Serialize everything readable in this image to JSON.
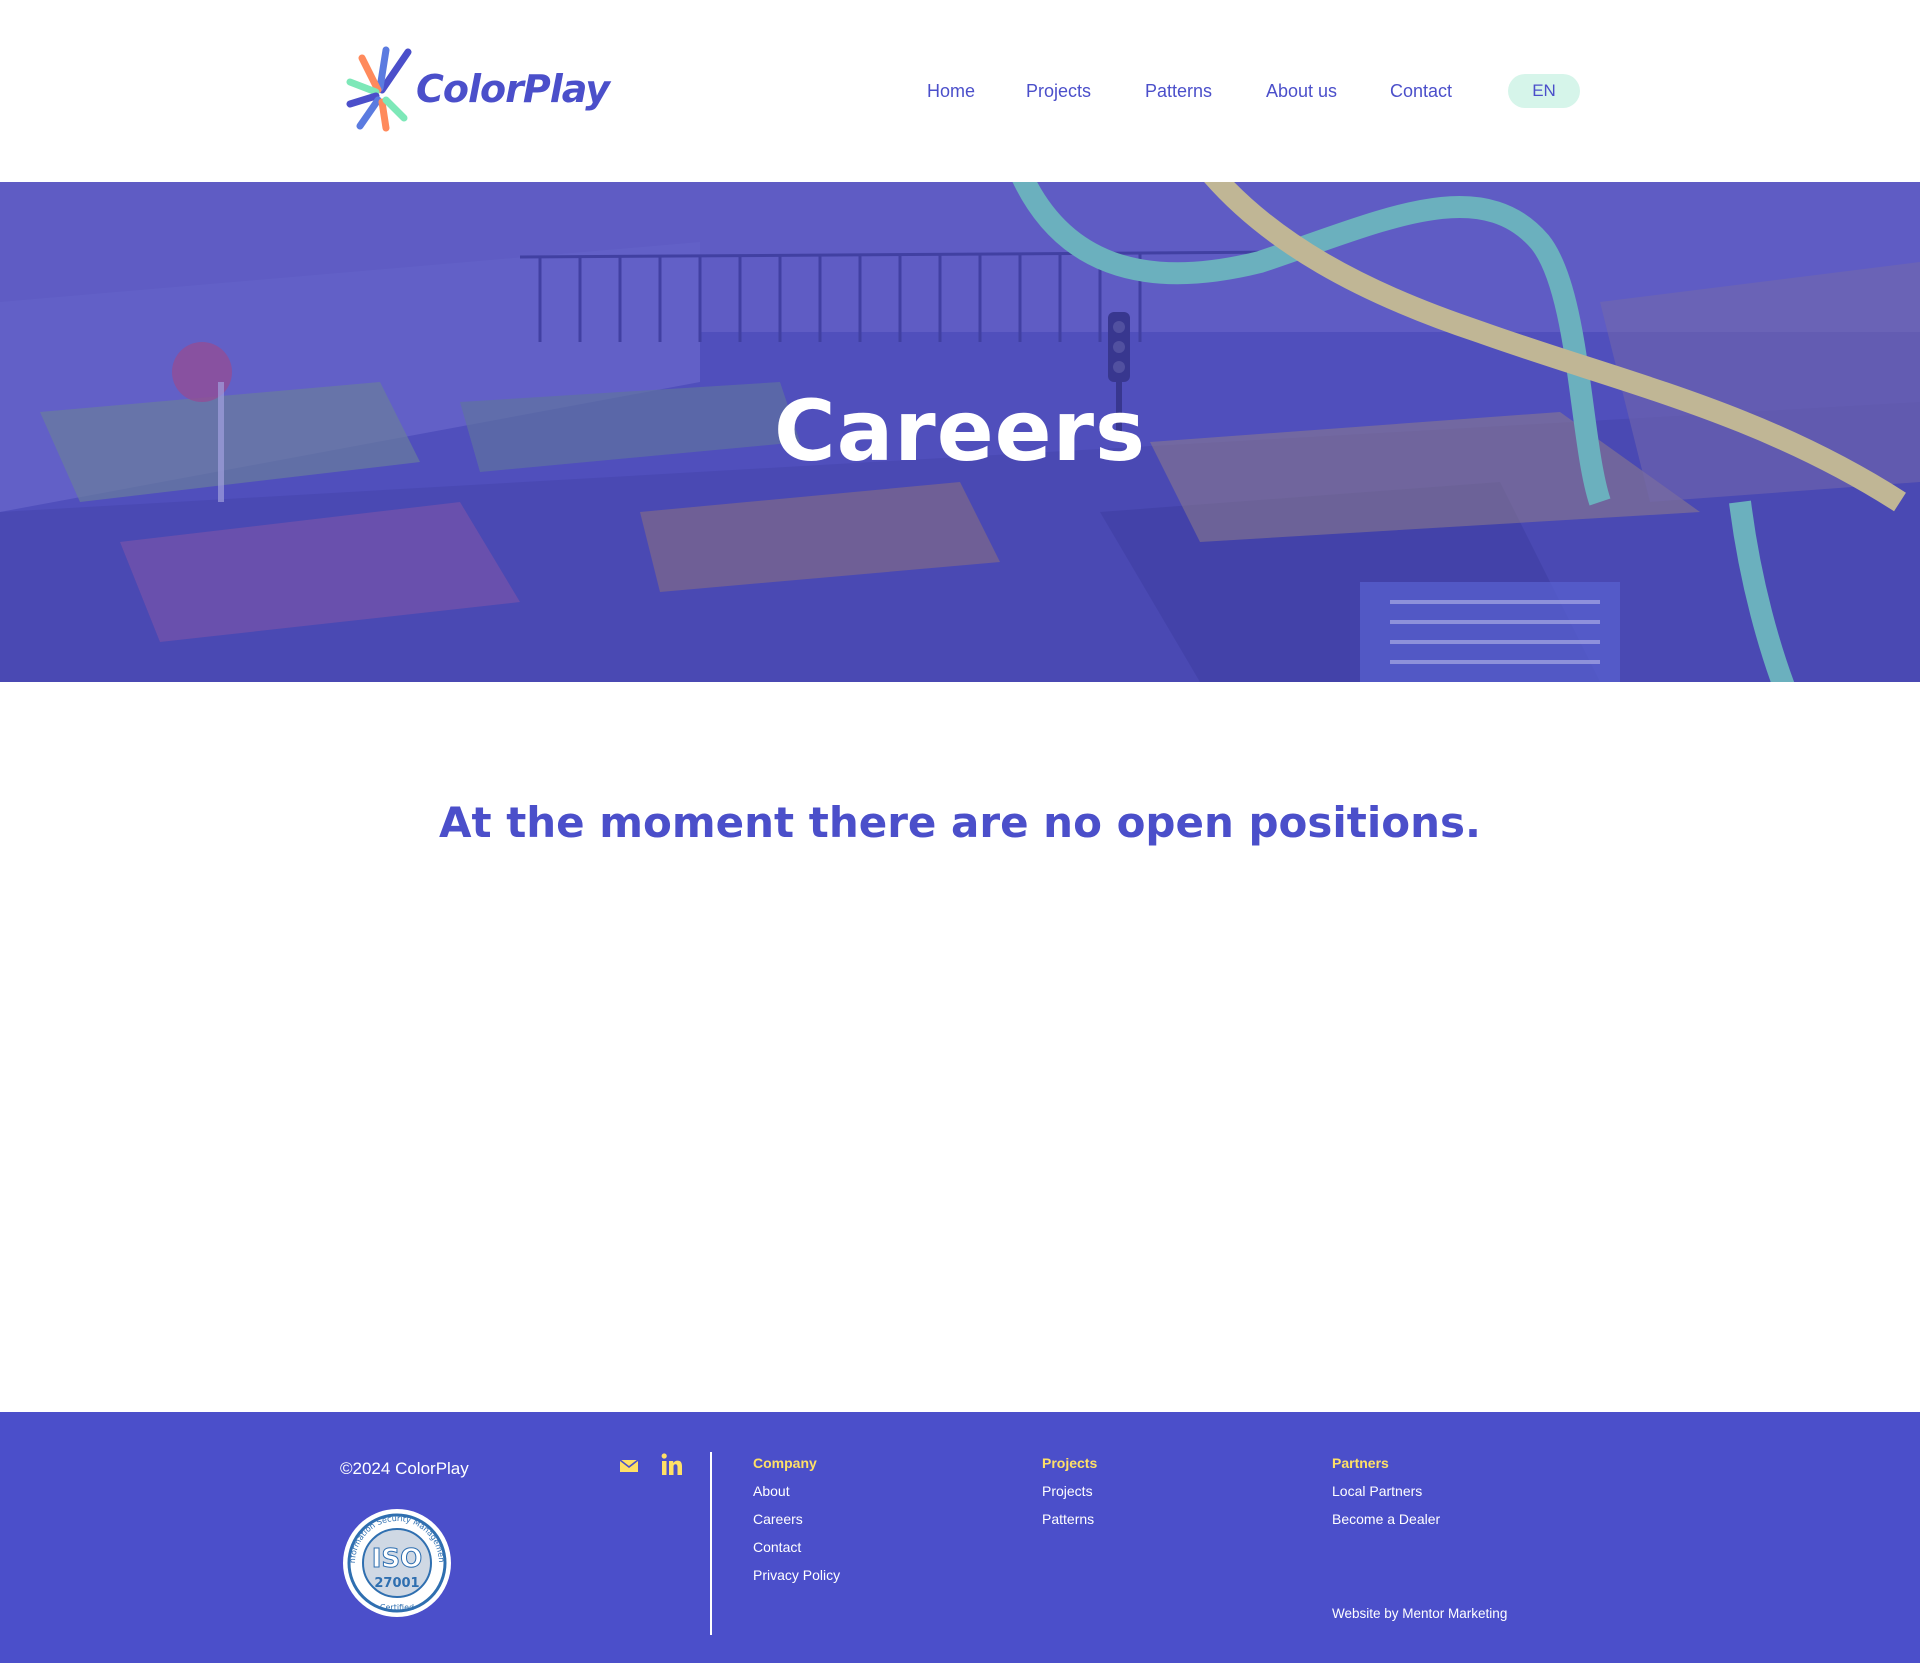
{
  "brand": {
    "name": "ColorPlay"
  },
  "nav": {
    "items": [
      {
        "label": "Home"
      },
      {
        "label": "Projects"
      },
      {
        "label": "Patterns"
      },
      {
        "label": "About us"
      },
      {
        "label": "Contact"
      }
    ],
    "language": "EN"
  },
  "hero": {
    "title": "Careers"
  },
  "main": {
    "message": "At the moment there are no open positions."
  },
  "footer": {
    "copyright": "©2024 ColorPlay",
    "badge": {
      "text_lines": [
        "Information Security Management",
        "ISO",
        "27001",
        "Certified"
      ]
    },
    "social": [
      "mail-icon",
      "linkedin-icon"
    ],
    "columns": [
      {
        "heading": "Company",
        "links": [
          "About",
          "Careers",
          "Contact",
          "Privacy Policy"
        ]
      },
      {
        "heading": "Projects",
        "links": [
          "Projects",
          "Patterns"
        ]
      },
      {
        "heading": "Partners",
        "links": [
          "Local Partners",
          "Become a Dealer"
        ]
      }
    ],
    "credit": "Website by  Mentor Marketing"
  },
  "colors": {
    "primary": "#4b4fca",
    "accent_yellow": "#ffe066",
    "accent_mint": "#7de8b8",
    "lang_bg": "#d6f5ea"
  }
}
